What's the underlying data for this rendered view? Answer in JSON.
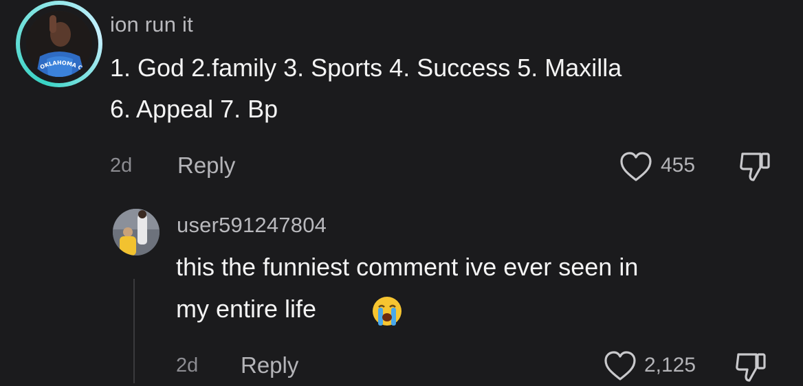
{
  "comment": {
    "username": "ion run it",
    "text_line1": "1. God 2.family 3. Sports 4. Success 5. Maxilla",
    "text_line2": "6. Appeal 7. Bp",
    "time": "2d",
    "reply_label": "Reply",
    "likes": "455",
    "avatar_badge_text": "OKLAHOMA CITY"
  },
  "reply": {
    "username": "user591247804",
    "text_line1": "this the funniest comment ive ever seen in",
    "text_line2": "my entire life",
    "emoji": "😭",
    "time": "2d",
    "reply_label": "Reply",
    "likes": "2,125"
  },
  "icons": {
    "like": "heart-outline-icon",
    "dislike": "thumbs-down-icon"
  },
  "colors": {
    "background": "#1b1b1d",
    "text": "#f4f4f4",
    "muted": "#8d8d92",
    "story_ring": "#38d3c4"
  }
}
